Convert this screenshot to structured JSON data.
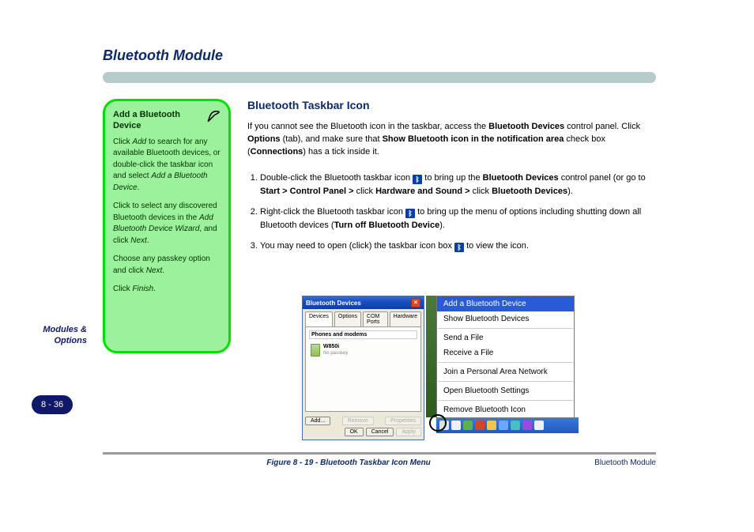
{
  "page": {
    "section_title": "Bluetooth Module",
    "side_label": "Modules & Options",
    "side_page_number": "8 - 36",
    "caption_left": " ",
    "caption_mid": "Figure 8 - 19 - Bluetooth Taskbar Icon Menu",
    "caption_right": "Bluetooth Module"
  },
  "note": {
    "title": "Add a Bluetooth Device",
    "body": [
      "Click <span class=\"em\">Add</span> to search for any available Bluetooth devices, or double-click the taskbar icon and select <span class=\"em\">Add a Bluetooth Device</span>.",
      "Click to select any discovered Bluetooth devices in the <span class=\"em\">Add Bluetooth Device Wizard</span>, and click <span class=\"em\">Next</span>.",
      "Choose any passkey option and click <span class=\"em\">Next</span>.",
      "Click <span class=\"em\">Finish</span>."
    ]
  },
  "main": {
    "subhead": "Bluetooth Taskbar Icon",
    "intro": "If you cannot see the Bluetooth icon in the taskbar, access the <b>Bluetooth Devices</b> control panel. Click <b>Options</b> (tab), and make sure that <b>Show Bluetooth icon in the notification area</b> check box (<b>Connections</b>) has a tick inside it.",
    "steps": [
      "Double-click the Bluetooth taskbar icon <span class=\"bt-icon\">ᛒ</span> to bring up the <b>Bluetooth Devices</b> control panel (or go to <b>Start &gt; Control Panel &gt;</b> click <b>Hardware and Sound &gt;</b> click <b>Bluetooth Devices</b>).",
      "Right-click the Bluetooth taskbar icon <span class=\"bt-icon\">ᛒ</span> to bring up the menu of options including shutting down all Bluetooth devices (<b>Turn off Bluetooth Device</b>).",
      "You may need to open (click) the taskbar icon box <span class=\"bt-icon\">ᛒ</span> to view the icon."
    ]
  },
  "win": {
    "title": "Bluetooth Devices",
    "tabs": [
      "Devices",
      "Options",
      "COM Ports",
      "Hardware"
    ],
    "group": "Phones and modems",
    "device_name": "W850i",
    "device_sub": "No passkey",
    "btn_add": "Add...",
    "btn_remove": "Remove",
    "btn_props": "Properties",
    "btn_ok": "OK",
    "btn_cancel": "Cancel",
    "btn_apply": "Apply"
  },
  "ctx": {
    "items": [
      {
        "label": "Add a Bluetooth Device",
        "sel": true
      },
      {
        "label": "Show Bluetooth Devices"
      },
      {
        "sep": true
      },
      {
        "label": "Send a File"
      },
      {
        "label": "Receive a File"
      },
      {
        "sep": true
      },
      {
        "label": "Join a Personal Area Network"
      },
      {
        "sep": true
      },
      {
        "label": "Open Bluetooth Settings"
      },
      {
        "sep": true
      },
      {
        "label": "Remove Bluetooth Icon"
      }
    ]
  }
}
